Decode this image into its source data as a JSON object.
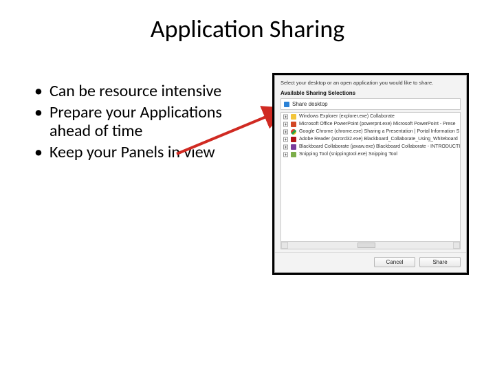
{
  "title": "Application Sharing",
  "bullets": [
    "Can be resource intensive",
    "Prepare your Applications ahead of time",
    "Keep your Panels in view"
  ],
  "dialog": {
    "instruction": "Select your desktop or an open application you would like to share.",
    "section_label": "Available Sharing Selections",
    "share_desktop": "Share desktop",
    "items": [
      {
        "icon": "ic-explorer",
        "text": "Windows Explorer (explorer.exe) Collaborate"
      },
      {
        "icon": "ic-ppt",
        "text": "Microsoft Office PowerPoint (powerpnt.exe) Microsoft PowerPoint - Prese"
      },
      {
        "icon": "ic-chrome",
        "text": "Google Chrome (chrome.exe) Sharing a Presentation | Portal Information S"
      },
      {
        "icon": "ic-pdf",
        "text": "Adobe Reader (acrord32.exe) Blackboard_Collaborate_Using_Whiteboard"
      },
      {
        "icon": "ic-bb",
        "text": "Blackboard Collaborate (javaw.exe) Blackboard Collaborate - INTRODUCTI"
      },
      {
        "icon": "ic-snip",
        "text": "Snipping Tool (snippingtool.exe) Snipping Tool"
      }
    ],
    "buttons": {
      "cancel": "Cancel",
      "share": "Share"
    }
  },
  "colors": {
    "arrow": "#d02a22"
  }
}
